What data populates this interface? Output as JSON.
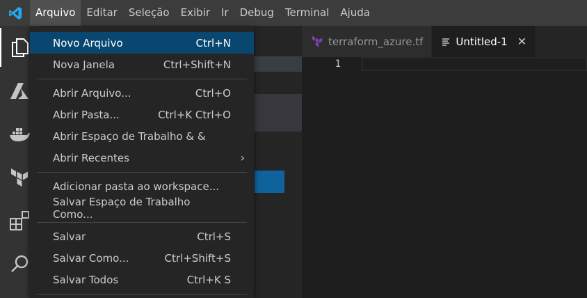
{
  "menubar": {
    "items": [
      {
        "label": "Arquivo",
        "active": true
      },
      {
        "label": "Editar"
      },
      {
        "label": "Seleção"
      },
      {
        "label": "Exibir"
      },
      {
        "label": "Ir"
      },
      {
        "label": "Debug"
      },
      {
        "label": "Terminal"
      },
      {
        "label": "Ajuda"
      }
    ]
  },
  "activitybar": {
    "icons": [
      "files-icon",
      "azure-icon",
      "docker-icon",
      "terraform-icon",
      "extensions-icon",
      "search-icon"
    ]
  },
  "tabs": [
    {
      "label": "terraform_azure.tf",
      "icon": "terraform-file-icon",
      "active": false
    },
    {
      "label": "Untitled-1",
      "icon": "text-file-icon",
      "active": true,
      "close": "✕"
    }
  ],
  "editor": {
    "line_number": "1"
  },
  "file_menu": {
    "groups": [
      [
        {
          "label": "Novo Arquivo",
          "shortcut": "Ctrl+N",
          "selected": true
        },
        {
          "label": "Nova Janela",
          "shortcut": "Ctrl+Shift+N"
        }
      ],
      [
        {
          "label": "Abrir Arquivo...",
          "shortcut": "Ctrl+O"
        },
        {
          "label": "Abrir Pasta...",
          "shortcut": "Ctrl+K Ctrl+O"
        },
        {
          "label": "Abrir Espaço de Trabalho & &",
          "shortcut": ""
        },
        {
          "label": "Abrir Recentes",
          "shortcut": "",
          "submenu": "›"
        }
      ],
      [
        {
          "label": "Adicionar pasta ao workspace...",
          "shortcut": ""
        },
        {
          "label": "Salvar Espaço de Trabalho Como...",
          "shortcut": ""
        }
      ],
      [
        {
          "label": "Salvar",
          "shortcut": "Ctrl+S"
        },
        {
          "label": "Salvar Como...",
          "shortcut": "Ctrl+Shift+S"
        },
        {
          "label": "Salvar Todos",
          "shortcut": "Ctrl+K S"
        }
      ]
    ]
  },
  "colors": {
    "menubar_bg": "#3c3c3c",
    "activitybar_bg": "#333333",
    "sidebar_bg": "#252526",
    "editor_bg": "#1e1e1e",
    "menu_selected_bg": "#094771",
    "accent_blue": "#0e639c",
    "vscode_logo": "#23a9f2",
    "terraform_purple": "#7b42bc"
  }
}
